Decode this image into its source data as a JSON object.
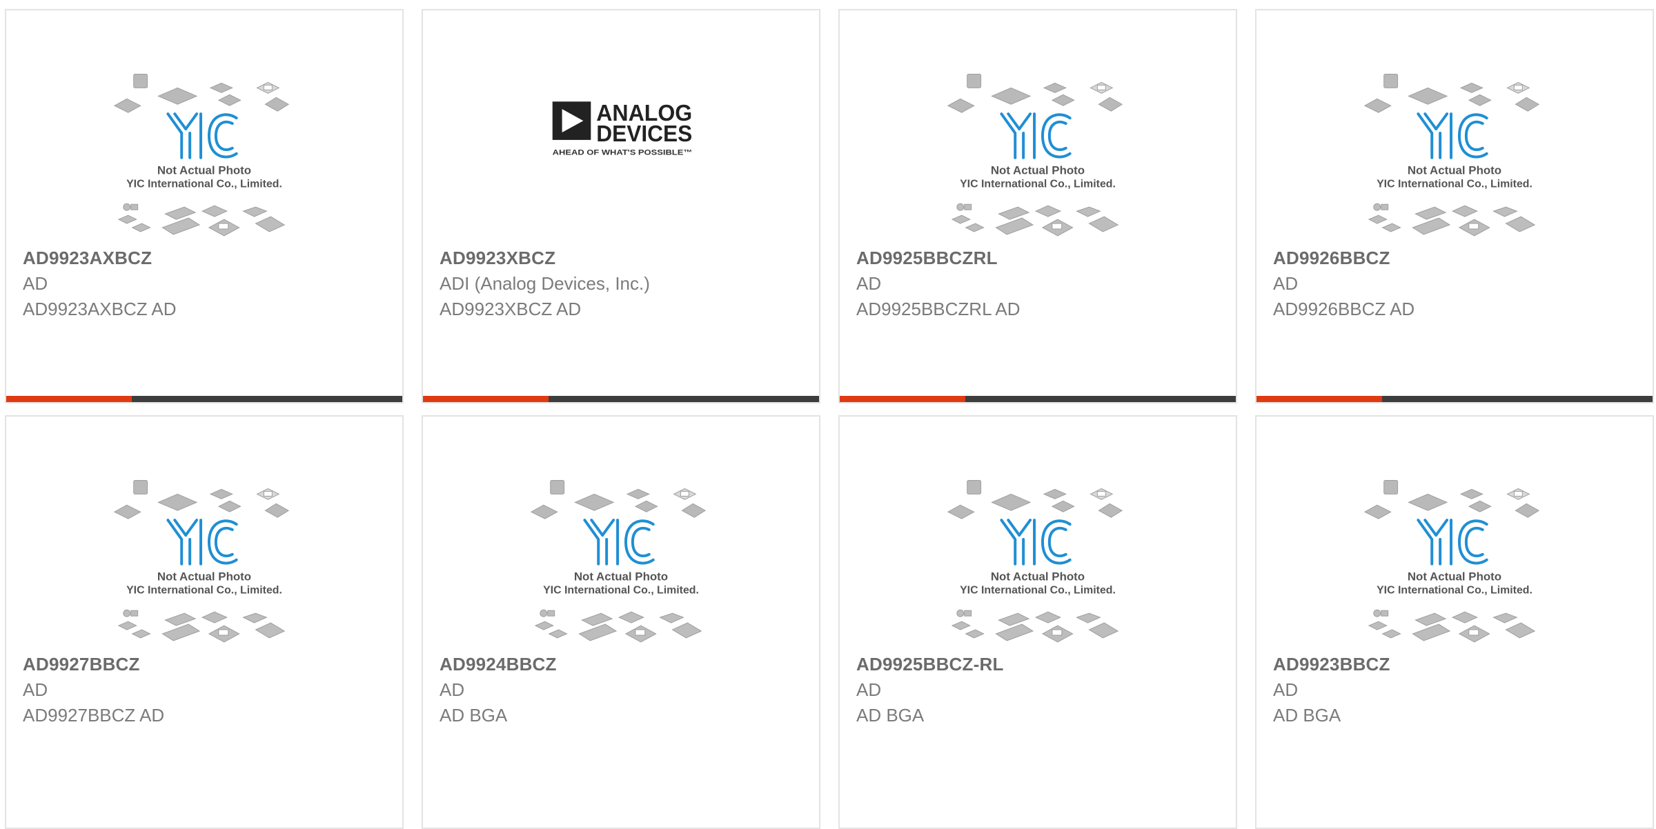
{
  "placeholder": {
    "caption_line1": "Not Actual Photo",
    "caption_line2": "YIC International Co., Limited.",
    "logo_text": "YIC"
  },
  "adi_logo": {
    "line1": "ANALOG",
    "line2": "DEVICES",
    "tagline": "AHEAD OF WHAT'S POSSIBLE™"
  },
  "colors": {
    "accent": "#e03a12",
    "bar": "#3d3d3d",
    "yic_blue": "#1f8fd4"
  },
  "products": [
    {
      "part": "AD9923AXBCZ",
      "brand": "AD",
      "desc": "AD9923AXBCZ AD",
      "image": "not-actual-photo"
    },
    {
      "part": "AD9923XBCZ",
      "brand": "ADI (Analog Devices, Inc.)",
      "desc": "AD9923XBCZ AD",
      "image": "analog-devices-logo"
    },
    {
      "part": "AD9925BBCZRL",
      "brand": "AD",
      "desc": "AD9925BBCZRL AD",
      "image": "not-actual-photo"
    },
    {
      "part": "AD9926BBCZ",
      "brand": "AD",
      "desc": "AD9926BBCZ AD",
      "image": "not-actual-photo"
    },
    {
      "part": "AD9927BBCZ",
      "brand": "AD",
      "desc": "AD9927BBCZ AD",
      "image": "not-actual-photo"
    },
    {
      "part": "AD9924BBCZ",
      "brand": "AD",
      "desc": "AD BGA",
      "image": "not-actual-photo"
    },
    {
      "part": "AD9925BBCZ-RL",
      "brand": "AD",
      "desc": "AD BGA",
      "image": "not-actual-photo"
    },
    {
      "part": "AD9923BBCZ",
      "brand": "AD",
      "desc": "AD BGA",
      "image": "not-actual-photo"
    }
  ]
}
